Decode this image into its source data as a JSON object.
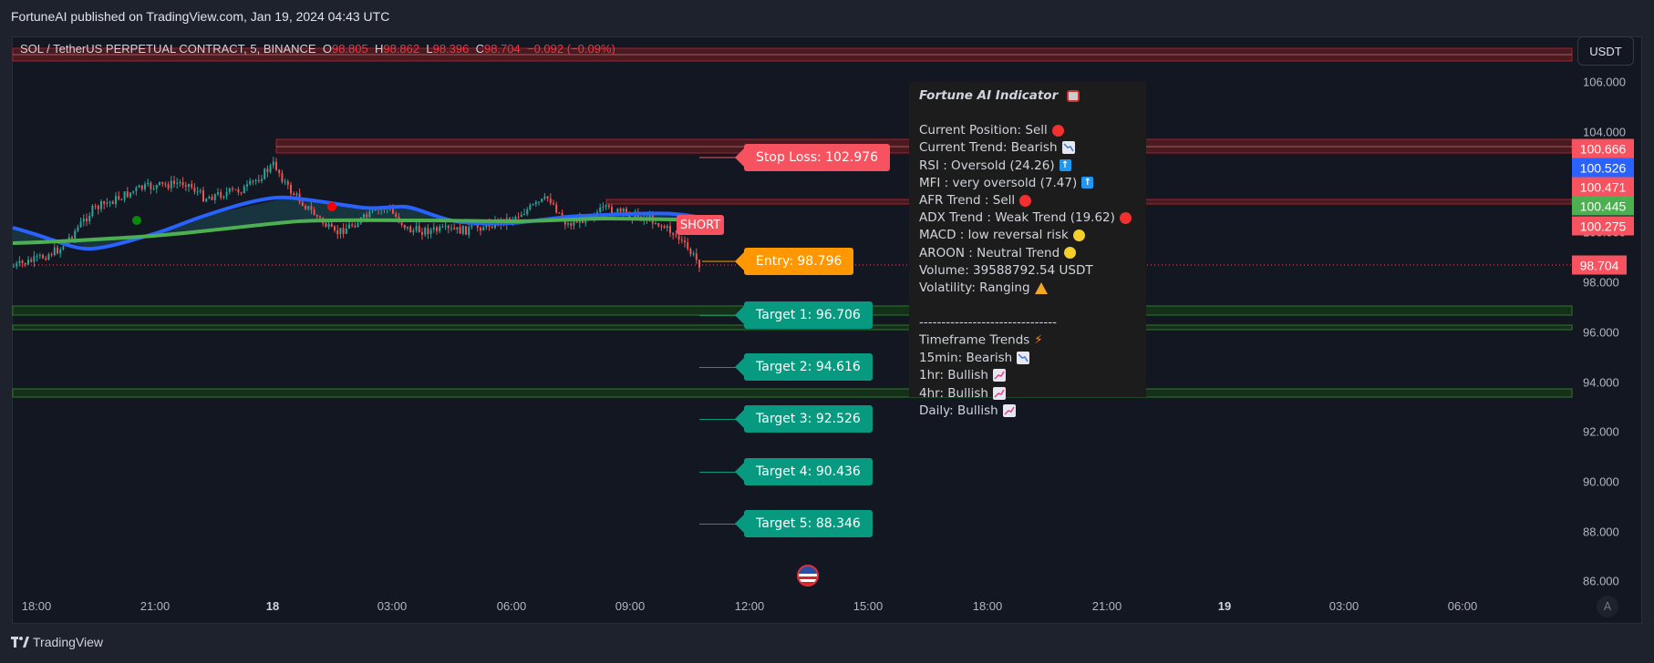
{
  "header": {
    "published": "FortuneAI published on TradingView.com, Jan 19, 2024 04:43 UTC"
  },
  "legend": {
    "symbol": "SOL / TetherUS PERPETUAL CONTRACT, 5, BINANCE",
    "o_label": "O",
    "o": "98.805",
    "h_label": "H",
    "h": "98.862",
    "l_label": "L",
    "l": "98.396",
    "c_label": "C",
    "c": "98.704",
    "change": "−0.092 (−0.09%)"
  },
  "currency_button": "USDT",
  "price_axis": {
    "ticks": [
      "106.000",
      "104.000",
      "100.000",
      "98.000",
      "96.000",
      "94.000",
      "92.000",
      "90.000",
      "88.000",
      "86.000"
    ],
    "labels": [
      {
        "value": "100.666",
        "color": "#f7525f"
      },
      {
        "value": "100.526",
        "color": "#2962ff"
      },
      {
        "value": "100.471",
        "color": "#f7525f"
      },
      {
        "value": "100.445",
        "color": "#4caf50"
      },
      {
        "value": "100.275",
        "color": "#f7525f"
      },
      {
        "value": "98.704",
        "color": "#f7525f"
      }
    ]
  },
  "time_axis": {
    "ticks": [
      "18:00",
      "21:00",
      "18",
      "03:00",
      "06:00",
      "09:00",
      "12:00",
      "15:00",
      "18:00",
      "21:00",
      "19",
      "03:00",
      "06:00"
    ]
  },
  "auto_button": "A",
  "trade_labels": {
    "stop_loss": "Stop Loss: 102.976",
    "entry": "Entry: 98.796",
    "targets": [
      "Target 1: 96.706",
      "Target 2: 94.616",
      "Target 3: 92.526",
      "Target 4: 90.436",
      "Target 5: 88.346"
    ],
    "short": "SHORT"
  },
  "colors": {
    "stop": "#f7525f",
    "entry": "#ff9800",
    "target": "#089981"
  },
  "panel": {
    "title": "Fortune AI Indicator",
    "lines": [
      {
        "text": "Current Position: Sell",
        "icon": "red-dot"
      },
      {
        "text": "Current Trend: Bearish",
        "icon": "chart-decreasing"
      },
      {
        "text": "RSI : Oversold (24.26)",
        "icon": "up-arrow"
      },
      {
        "text": "MFI : very oversold (7.47)",
        "icon": "up-arrow"
      },
      {
        "text": "AFR Trend : Sell",
        "icon": "red-dot"
      },
      {
        "text": "ADX Trend : Weak Trend (19.62)",
        "icon": "red-dot"
      },
      {
        "text": "MACD : low reversal risk",
        "icon": "yellow-dot"
      },
      {
        "text": "AROON : Neutral Trend",
        "icon": "yellow-dot"
      },
      {
        "text": "Volume: 39588792.54 USDT",
        "icon": ""
      },
      {
        "text": "Volatility: Ranging",
        "icon": "warning"
      }
    ],
    "separator": "-------------------------------",
    "tf_lines": [
      {
        "text": "Timeframe Trends",
        "icon": "lightning"
      },
      {
        "text": "15min: Bearish",
        "icon": "chart-decreasing"
      },
      {
        "text": "1hr: Bullish",
        "icon": "chart-increasing"
      },
      {
        "text": "4hr: Bullish",
        "icon": "chart-increasing"
      },
      {
        "text": "Daily: Bullish",
        "icon": "chart-increasing"
      }
    ]
  },
  "footer": {
    "brand": "TradingView"
  }
}
